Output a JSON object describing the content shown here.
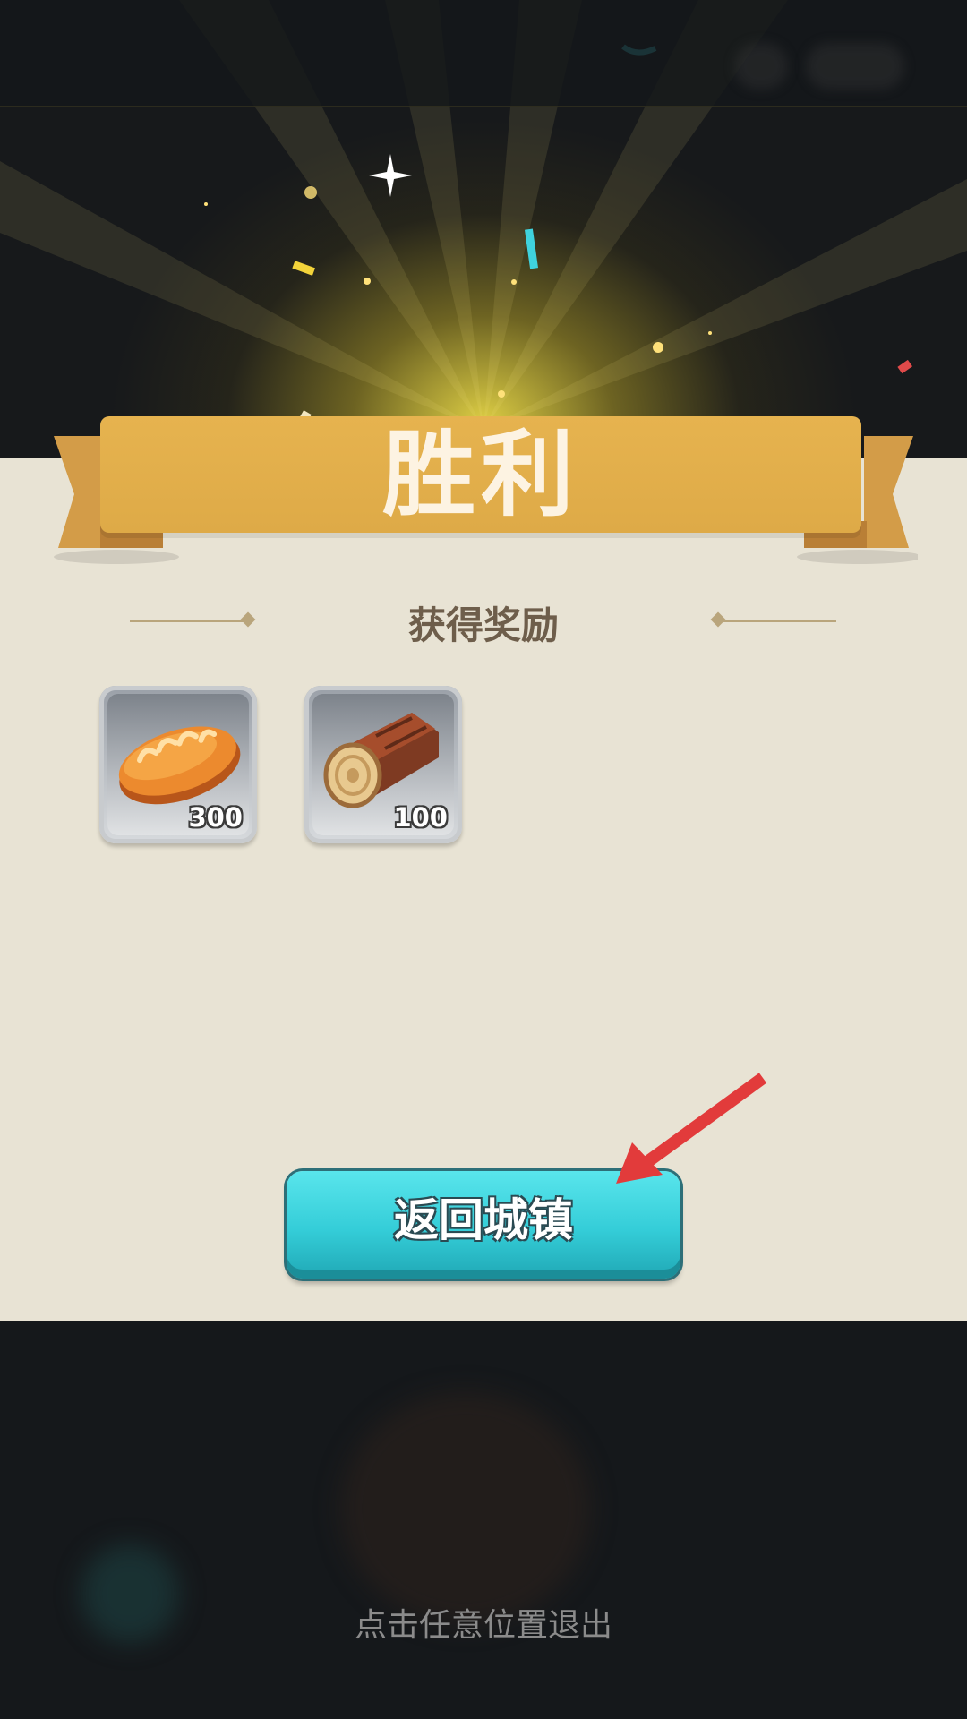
{
  "result_banner": {
    "title": "胜利"
  },
  "rewards_section": {
    "title": "获得奖励",
    "items": [
      {
        "icon": "bread-icon",
        "count": "300"
      },
      {
        "icon": "wood-log-icon",
        "count": "100"
      }
    ]
  },
  "return_button": {
    "label": "返回城镇"
  },
  "exit_hint": "点击任意位置退出",
  "colors": {
    "panel": "#e8e3d4",
    "ribbon": "#e2ad4b",
    "button": "#34cdd8",
    "arrow": "#e23b3b",
    "background": "#15181b"
  }
}
